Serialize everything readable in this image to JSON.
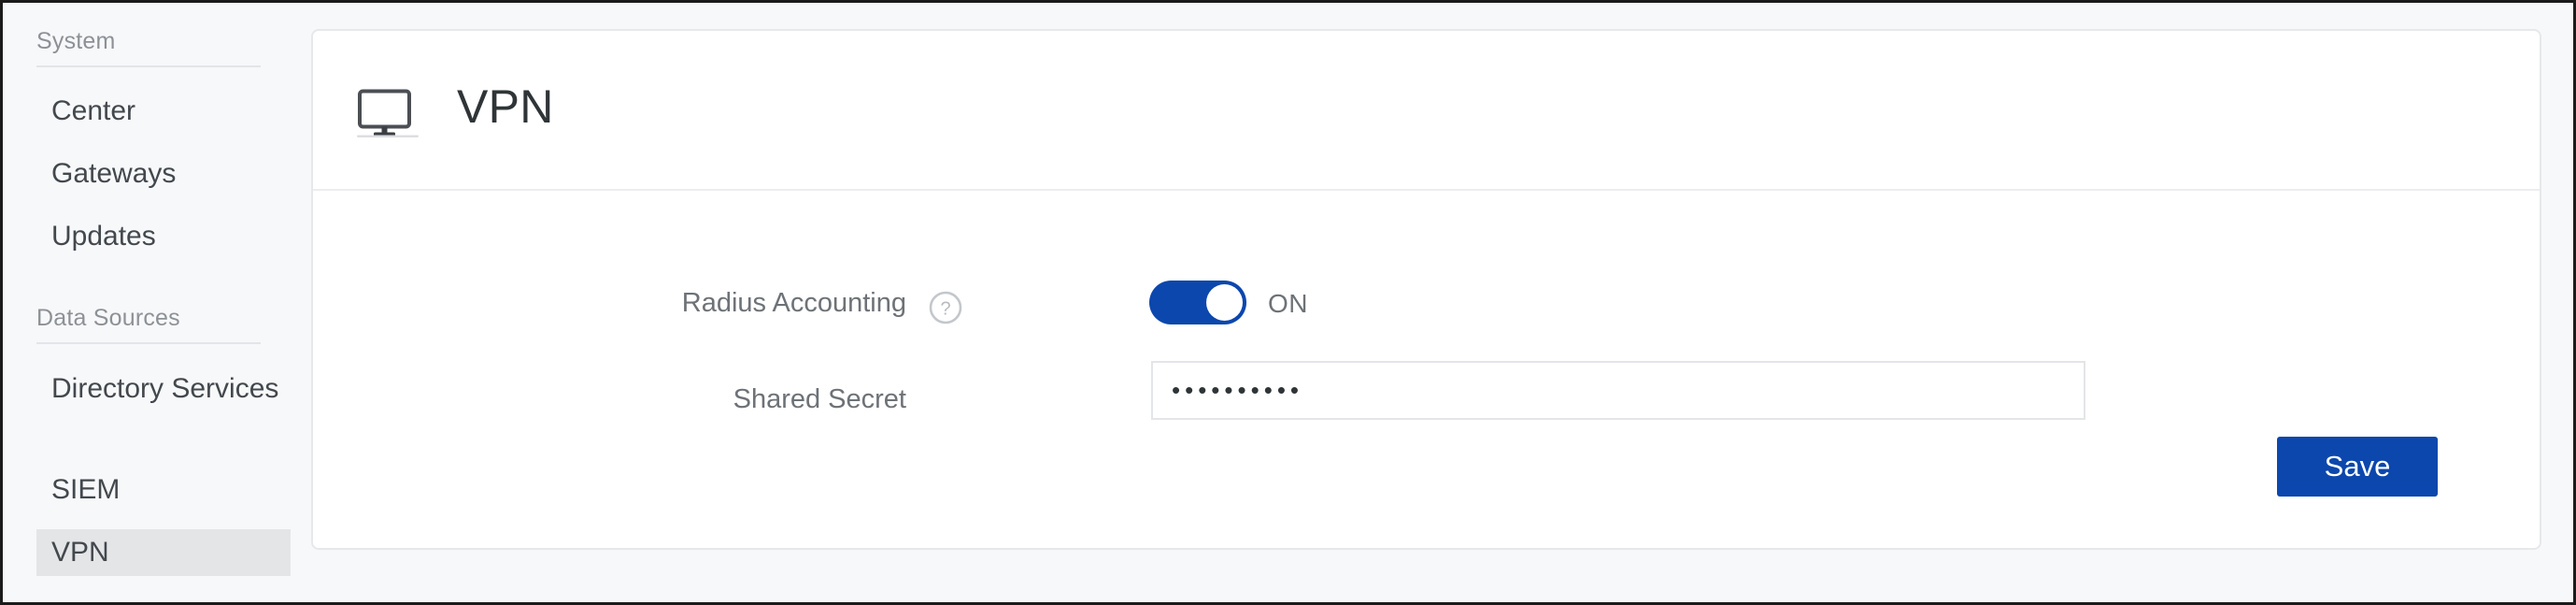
{
  "sidebar": {
    "sections": [
      {
        "heading": "System",
        "items": [
          {
            "label": "Center",
            "selected": false
          },
          {
            "label": "Gateways",
            "selected": false
          },
          {
            "label": "Updates",
            "selected": false
          }
        ]
      },
      {
        "heading": "Data Sources",
        "items": [
          {
            "label": "Directory Services",
            "selected": false
          },
          {
            "label": "SIEM",
            "selected": false
          },
          {
            "label": "VPN",
            "selected": true
          }
        ]
      }
    ]
  },
  "card": {
    "icon": "monitor-icon",
    "title": "VPN",
    "fields": {
      "radius_accounting": {
        "label": "Radius Accounting",
        "help_icon": "help-circle-icon",
        "toggle_state": "ON",
        "toggle_on": true
      },
      "shared_secret": {
        "label": "Shared Secret",
        "value": "••••••••••",
        "placeholder": ""
      }
    },
    "save_label": "Save"
  },
  "colors": {
    "accent": "#0c47ad",
    "page_bg": "#f7f8fa",
    "card_bg": "#ffffff",
    "selected_item_bg": "#e4e5e7",
    "label_text": "#6d7277",
    "nav_text": "#43484d",
    "section_text": "#8d9196"
  }
}
